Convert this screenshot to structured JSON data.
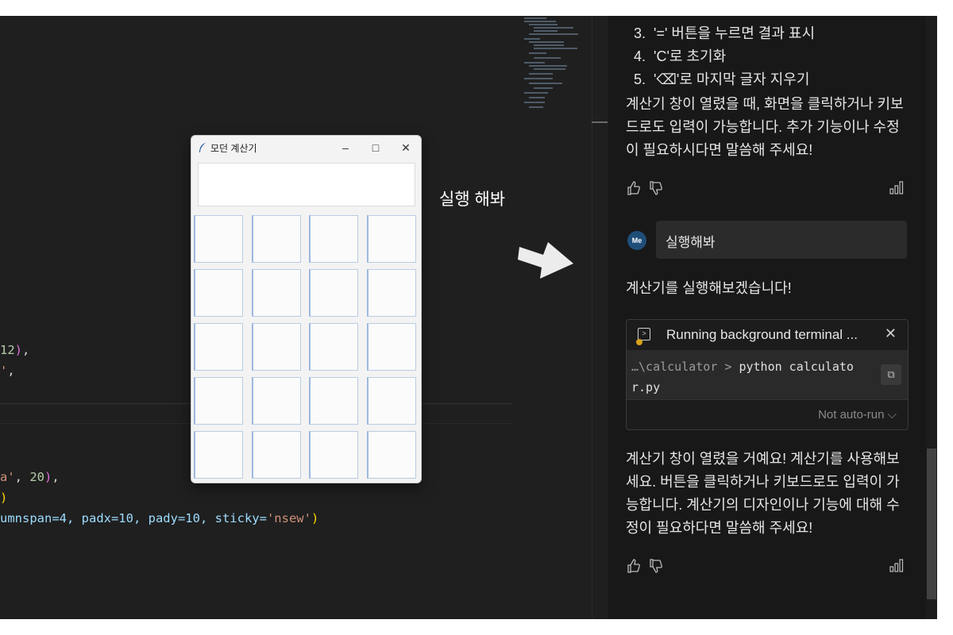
{
  "editor": {
    "lines": [
      {
        "pre": "",
        "num": "12",
        "close": ")",
        "tail": ","
      },
      {
        "pre": "",
        "str": "'",
        "tail": ","
      },
      {
        "pre": "",
        "str": "a'",
        "mid": ", ",
        "num": "20",
        "close": ")",
        "tail": ","
      },
      {
        "pre": "",
        "close2": ")"
      },
      {
        "pre": "umnspan=4, padx=10, pady=10, sticky=",
        "str": "'nsew'",
        "close": ")"
      }
    ]
  },
  "calculator_window": {
    "title": "모던 계산기",
    "minimize": "–",
    "maximize": "□",
    "close": "✕",
    "icon": "feather-icon"
  },
  "annotation": {
    "text": "실행 해봐",
    "icon": "arrow-right-icon"
  },
  "chat": {
    "list_items": [
      {
        "num": "3.",
        "text": "'=' 버튼을 누르면 결과 표시"
      },
      {
        "num": "4.",
        "text": "'C'로 초기화"
      },
      {
        "num": "5.",
        "text": "'⌫'로 마지막 글자 지우기"
      }
    ],
    "para1": "계산기 창이 열렸을 때, 화면을 클릭하거나 키보드로도 입력이 가능합니다. 추가 기능이나 수정이 필요하시다면 말씀해 주세요!",
    "user_avatar": "Me",
    "user_message": "실행해봐",
    "assistant_intro": "계산기를 실행해보겠습니다!",
    "terminal": {
      "title": "Running background terminal ...",
      "close": "✕",
      "command_path": "…\\calculator > ",
      "command_line1": "python calculato",
      "command_line2": "r.py",
      "autorun": "Not auto-run ⌵"
    },
    "para2": "계산기 창이 열렸을 거예요! 계산기를 사용해보세요. 버튼을 클릭하거나 키보드로도 입력이 가능합니다. 계산기의 디자인이나 기능에 대해 수정이 필요하다면 말씀해 주세요!",
    "thumbs_up": "👍",
    "thumbs_down": "👎",
    "signal": "📶"
  },
  "colors": {
    "editor_bg": "#1f1f1f",
    "chat_bg": "#181818",
    "string": "#ce9178",
    "number": "#b5cea8",
    "paren": "#da70d6"
  }
}
